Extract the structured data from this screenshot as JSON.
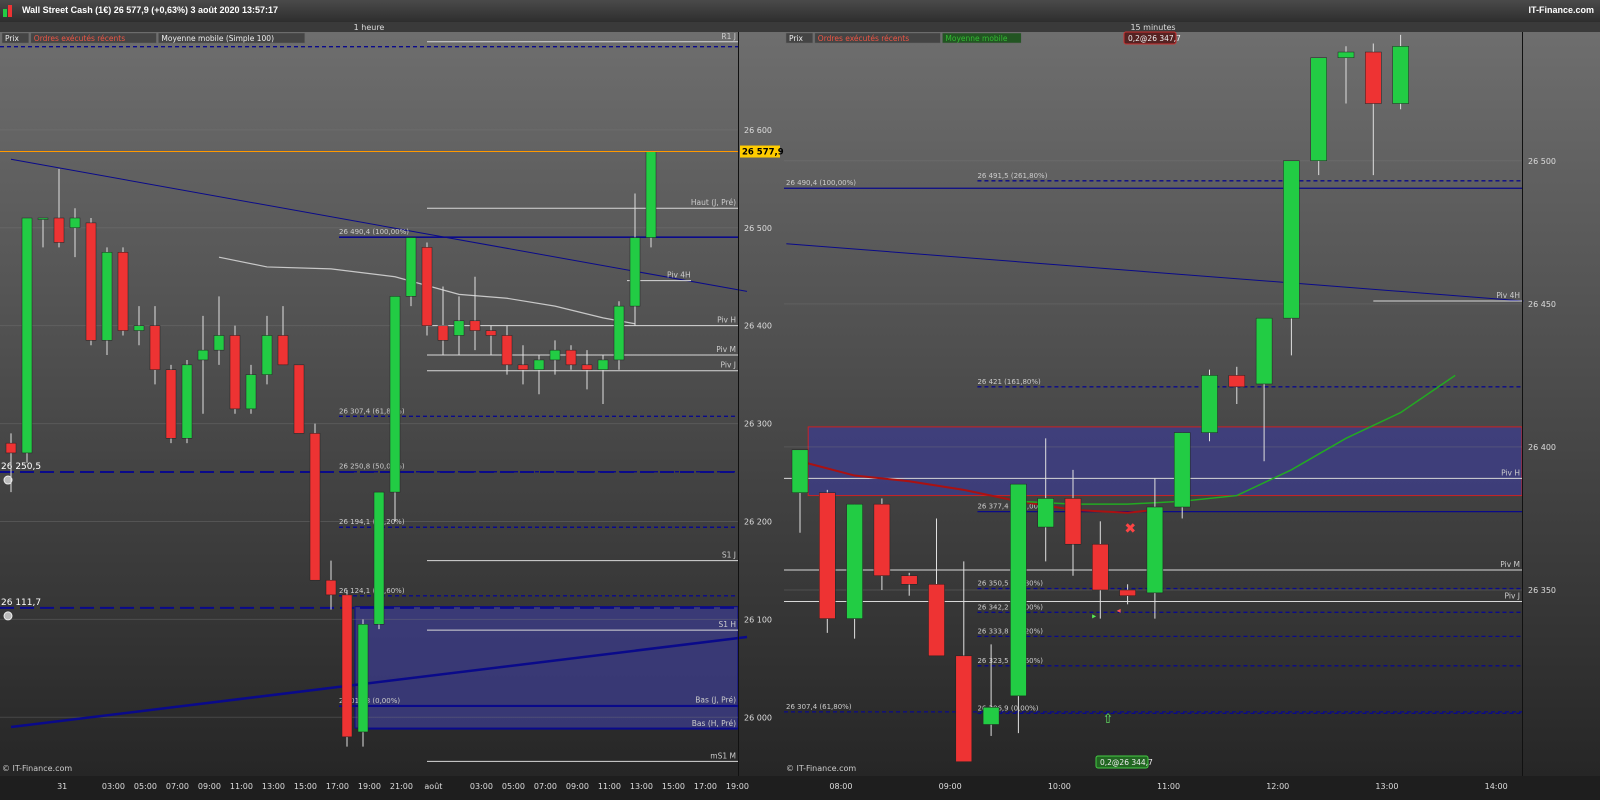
{
  "window": {
    "title": "Wall Street Cash (1€)   26 577,9 (+0,63%)   3 août 2020 13:57:17",
    "brand": "IT-Finance.com"
  },
  "colors": {
    "up": "#22cc44",
    "down": "#ee3333",
    "blue": "#0a0a8a",
    "zone": "#3a3a80",
    "white": "#e0e0e0",
    "orange": "#ff9900"
  },
  "chart_data": [
    {
      "type": "candlestick",
      "title": "1 heure",
      "legend": [
        "Prix",
        "Ordres exécutés récents",
        "Moyenne mobile (Simple 100)"
      ],
      "watermark": "© IT-Finance.com",
      "ylim": [
        25940,
        26700
      ],
      "y_ticks": [
        26000,
        26100,
        26200,
        26300,
        26400,
        26500,
        26600
      ],
      "y_tick_labels": [
        "26 000",
        "26 100",
        "26 200",
        "26 300",
        "26 400",
        "26 500",
        "26 600"
      ],
      "x_labels": [
        "31",
        "03:00",
        "05:00",
        "07:00",
        "09:00",
        "11:00",
        "13:00",
        "15:00",
        "17:00",
        "19:00",
        "21:00",
        "août",
        "03:00",
        "05:00",
        "07:00",
        "09:00",
        "11:00",
        "13:00",
        "15:00",
        "17:00",
        "19:00"
      ],
      "x_label_bar": [
        3.2,
        6.4,
        8.4,
        10.4,
        12.4,
        14.4,
        16.4,
        18.4,
        20.4,
        22.4,
        24.4,
        26.4,
        29.4,
        31.4,
        33.4,
        35.4,
        37.4,
        39.4,
        41.4,
        43.4,
        45.4
      ],
      "last_price": 26577.9,
      "last_price_label": "26 577,9",
      "candles": [
        [
          26280,
          26290,
          26230,
          26270
        ],
        [
          26270,
          26510,
          26260,
          26510
        ],
        [
          26510,
          26510,
          26480,
          26510
        ],
        [
          26510,
          26560,
          26480,
          26485
        ],
        [
          26500,
          26520,
          26470,
          26510
        ],
        [
          26505,
          26510,
          26380,
          26385
        ],
        [
          26385,
          26480,
          26370,
          26475
        ],
        [
          26475,
          26480,
          26390,
          26395
        ],
        [
          26395,
          26420,
          26380,
          26400
        ],
        [
          26400,
          26420,
          26340,
          26355
        ],
        [
          26355,
          26360,
          26280,
          26285
        ],
        [
          26285,
          26365,
          26280,
          26360
        ],
        [
          26365,
          26410,
          26310,
          26375
        ],
        [
          26375,
          26430,
          26360,
          26390
        ],
        [
          26390,
          26400,
          26310,
          26315
        ],
        [
          26315,
          26360,
          26310,
          26350
        ],
        [
          26350,
          26410,
          26340,
          26390
        ],
        [
          26390,
          26420,
          26360,
          26360
        ],
        [
          26360,
          26360,
          26290,
          26290
        ],
        [
          26290,
          26300,
          26140,
          26140
        ],
        [
          26140,
          26160,
          26110,
          26125
        ],
        [
          26125,
          26130,
          25970,
          25980
        ],
        [
          25985,
          26100,
          25970,
          26095
        ],
        [
          26095,
          26230,
          26090,
          26230
        ],
        [
          26230,
          26430,
          26200,
          26430
        ],
        [
          26430,
          26490,
          26420,
          26490
        ],
        [
          26480,
          26485,
          26390,
          26400
        ],
        [
          26400,
          26440,
          26370,
          26385
        ],
        [
          26390,
          26430,
          26370,
          26405
        ],
        [
          26405,
          26450,
          26375,
          26395
        ],
        [
          26395,
          26400,
          26370,
          26390
        ],
        [
          26390,
          26400,
          26350,
          26360
        ],
        [
          26360,
          26380,
          26340,
          26355
        ],
        [
          26355,
          26370,
          26330,
          26365
        ],
        [
          26365,
          26385,
          26350,
          26375
        ],
        [
          26375,
          26380,
          26355,
          26360
        ],
        [
          26360,
          26375,
          26335,
          26355
        ],
        [
          26355,
          26370,
          26320,
          26365
        ],
        [
          26365,
          26425,
          26355,
          26420
        ],
        [
          26420,
          26535,
          26400,
          26490
        ],
        [
          26490,
          26578,
          26480,
          26578
        ]
      ],
      "sma": [
        [
          13,
          26470
        ],
        [
          16,
          26460
        ],
        [
          20,
          26458
        ],
        [
          24,
          26450
        ],
        [
          28,
          26432
        ],
        [
          31,
          26428
        ],
        [
          34,
          26420
        ],
        [
          37,
          26408
        ],
        [
          39,
          26402
        ]
      ],
      "h_lines": [
        {
          "y": 26690,
          "label": "R1 J",
          "style": "white",
          "from": 26
        },
        {
          "y": 26685,
          "label": "",
          "style": "dash"
        },
        {
          "y": 26520,
          "label": "Haut (J, Pré)",
          "style": "white",
          "from": 26
        },
        {
          "y": 26446,
          "label": "Piv 4H",
          "style": "white",
          "from": 38.5,
          "to": 42.5,
          "lbl_at": 41
        },
        {
          "y": 26400,
          "label": "Piv H",
          "style": "white",
          "from": 26
        },
        {
          "y": 26370,
          "label": "Piv M",
          "style": "white",
          "from": 26
        },
        {
          "y": 26354,
          "label": "Piv J",
          "style": "white",
          "from": 26
        },
        {
          "y": 26160,
          "label": "S1 J",
          "style": "white",
          "from": 26
        },
        {
          "y": 26089,
          "label": "S1 H",
          "style": "white",
          "from": 26
        },
        {
          "y": 26012,
          "label": "Bas (J, Pré)",
          "style": "solid",
          "from": 21
        },
        {
          "y": 25988,
          "label": "Bas (H, Pré)",
          "style": "solid",
          "from": 22
        },
        {
          "y": 25955,
          "label": "mS1 M",
          "style": "white",
          "from": 26
        }
      ],
      "fibo": [
        {
          "y": 26490.4,
          "label": "26 490,4 (100,00%)",
          "style": "solid"
        },
        {
          "y": 26307.4,
          "label": "26 307,4 (61,80%)",
          "style": "dash"
        },
        {
          "y": 26250.8,
          "label": "26 250,8 (50,00%)",
          "style": "dash"
        },
        {
          "y": 26194.1,
          "label": "26 194,1 (38,20%)",
          "style": "dash"
        },
        {
          "y": 26124.1,
          "label": "26 124,1 (23,60%)",
          "style": "dash"
        },
        {
          "y": 26011.3,
          "label": "26 011,3 (0,00%)",
          "style": "solid"
        }
      ],
      "levels": [
        {
          "y": 26250.5,
          "label": "26 250,5"
        },
        {
          "y": 26111.7,
          "label": "26 111,7"
        }
      ],
      "zones": [
        {
          "y1": 26113,
          "y2": 25989,
          "from": 21.5
        }
      ],
      "trendlines": [
        {
          "p1": [
            0,
            26570
          ],
          "p2": [
            46,
            26435
          ],
          "w": 1
        },
        {
          "p1": [
            0,
            25990
          ],
          "p2": [
            46,
            26082
          ],
          "w": 2.5
        }
      ]
    },
    {
      "type": "candlestick",
      "title": "15 minutes",
      "legend": [
        "Prix",
        "Ordres exécutés récents",
        "Moyenne mobile"
      ],
      "watermark": "© IT-Finance.com",
      "ylim": [
        26285,
        26545
      ],
      "y_ticks": [
        26350,
        26400,
        26450,
        26500
      ],
      "y_tick_labels": [
        "26 350",
        "26 400",
        "26 450",
        "26 500"
      ],
      "x_labels": [
        "08:00",
        "09:00",
        "10:00",
        "11:00",
        "12:00",
        "13:00",
        "14:00"
      ],
      "x_label_bar": [
        1.5,
        5.5,
        9.5,
        13.5,
        17.5,
        21.5,
        25.5
      ],
      "badge_top": "0,2@26 347,7",
      "badge_bottom": "0,2@26 344,7",
      "candles": [
        [
          26384,
          26389,
          26370,
          26399
        ],
        [
          26384,
          26385,
          26335,
          26340
        ],
        [
          26340,
          26380,
          26333,
          26380
        ],
        [
          26380,
          26382,
          26350,
          26355
        ],
        [
          26355,
          26356,
          26348,
          26352
        ],
        [
          26352,
          26375,
          26328,
          26327
        ],
        [
          26327,
          26360,
          26300,
          26290
        ],
        [
          26303,
          26331,
          26299,
          26309
        ],
        [
          26313,
          26372,
          26300,
          26387
        ],
        [
          26372,
          26403,
          26360,
          26382
        ],
        [
          26382,
          26392,
          26355,
          26366
        ],
        [
          26366,
          26374,
          26340,
          26350
        ],
        [
          26350,
          26352,
          26345,
          26348
        ],
        [
          26349,
          26389,
          26340,
          26379
        ],
        [
          26379,
          26405,
          26375,
          26405
        ],
        [
          26405,
          26427,
          26402,
          26425
        ],
        [
          26425,
          26428,
          26415,
          26421
        ],
        [
          26422,
          26436,
          26395,
          26445
        ],
        [
          26445,
          26498,
          26432,
          26500
        ],
        [
          26500,
          26535,
          26495,
          26536
        ],
        [
          26536,
          26540,
          26520,
          26538
        ],
        [
          26538,
          26541,
          26495,
          26520
        ],
        [
          26520,
          26544,
          26518,
          26540
        ]
      ],
      "ma_red": [
        [
          0,
          26395
        ],
        [
          2,
          26390
        ],
        [
          4,
          26388
        ],
        [
          6,
          26385
        ],
        [
          8,
          26381
        ],
        [
          10,
          26378
        ],
        [
          12,
          26377
        ],
        [
          13,
          26378
        ]
      ],
      "ma_green": [
        [
          8,
          26381
        ],
        [
          10,
          26380
        ],
        [
          12,
          26380
        ],
        [
          14,
          26381
        ],
        [
          16,
          26383
        ],
        [
          18,
          26392
        ],
        [
          20,
          26403
        ],
        [
          22,
          26412
        ],
        [
          24,
          26425
        ]
      ],
      "h_lines": [
        {
          "y": 26490.4,
          "label": "26 490,4 (100,00%)",
          "style": "solid",
          "lbl_at": 0
        },
        {
          "y": 26493,
          "label": "26 491,5 (261,80%)",
          "style": "dash",
          "from": 6.5,
          "lbl_at": 6.5
        },
        {
          "y": 26451,
          "label": "Piv 4H",
          "style": "white",
          "from": 21
        },
        {
          "y": 26421,
          "label": "26 421 (161,80%)",
          "style": "dash",
          "from": 6.5,
          "lbl_at": 6.5
        },
        {
          "y": 26389,
          "label": "Piv H",
          "style": "white"
        },
        {
          "y": 26377.4,
          "label": "26 377,4 (100,00%)",
          "style": "solid",
          "from": 6.5,
          "lbl_at": 6.5
        },
        {
          "y": 26357,
          "label": "Piv M",
          "style": "white"
        },
        {
          "y": 26350.5,
          "label": "26 350,5 (61,80%)",
          "style": "dash",
          "from": 6.5,
          "lbl_at": 6.5
        },
        {
          "y": 26346,
          "label": "Piv J",
          "style": "white"
        },
        {
          "y": 26342.2,
          "label": "26 342,2 (50,00%)",
          "style": "dash",
          "from": 6.5,
          "lbl_at": 6.5
        },
        {
          "y": 26333.8,
          "label": "26 333,8 (38,20%)",
          "style": "dash",
          "from": 6.5,
          "lbl_at": 6.5
        },
        {
          "y": 26323.5,
          "label": "26 323,5 (23,60%)",
          "style": "dash",
          "from": 6.5,
          "lbl_at": 6.5
        },
        {
          "y": 26307.4,
          "label": "26 307,4 (61,80%)",
          "style": "dash",
          "lbl_at": 0
        },
        {
          "y": 26306.9,
          "label": "26 306,9 (0,00%)",
          "style": "dash",
          "from": 6.5,
          "lbl_at": 6.5,
          "nolbl": false
        }
      ],
      "zones": [
        {
          "y1": 26407,
          "y2": 26383,
          "from": 0.3
        }
      ],
      "trendlines": [
        {
          "p1": [
            -0.5,
            26471
          ],
          "p2": [
            26.5,
            26451
          ],
          "w": 1
        }
      ]
    }
  ]
}
